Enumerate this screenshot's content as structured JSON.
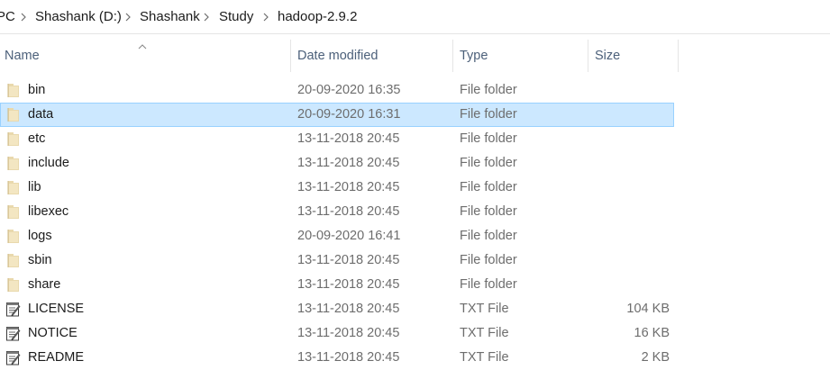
{
  "breadcrumb": {
    "items": [
      {
        "label": "PC"
      },
      {
        "label": "Shashank (D:)"
      },
      {
        "label": "Shashank"
      },
      {
        "label": "Study"
      },
      {
        "label": "hadoop-2.9.2"
      }
    ]
  },
  "columns": {
    "name": "Name",
    "date_modified": "Date modified",
    "type": "Type",
    "size": "Size",
    "sort_indicator_icon": "chevron-up-icon"
  },
  "files": [
    {
      "name": "bin",
      "date": "20-09-2020 16:35",
      "type": "File folder",
      "size": "",
      "icon": "folder-icon",
      "selected": false
    },
    {
      "name": "data",
      "date": "20-09-2020 16:31",
      "type": "File folder",
      "size": "",
      "icon": "folder-icon",
      "selected": true
    },
    {
      "name": "etc",
      "date": "13-11-2018 20:45",
      "type": "File folder",
      "size": "",
      "icon": "folder-icon",
      "selected": false
    },
    {
      "name": "include",
      "date": "13-11-2018 20:45",
      "type": "File folder",
      "size": "",
      "icon": "folder-icon",
      "selected": false
    },
    {
      "name": "lib",
      "date": "13-11-2018 20:45",
      "type": "File folder",
      "size": "",
      "icon": "folder-icon",
      "selected": false
    },
    {
      "name": "libexec",
      "date": "13-11-2018 20:45",
      "type": "File folder",
      "size": "",
      "icon": "folder-icon",
      "selected": false
    },
    {
      "name": "logs",
      "date": "20-09-2020 16:41",
      "type": "File folder",
      "size": "",
      "icon": "folder-icon",
      "selected": false
    },
    {
      "name": "sbin",
      "date": "13-11-2018 20:45",
      "type": "File folder",
      "size": "",
      "icon": "folder-icon",
      "selected": false
    },
    {
      "name": "share",
      "date": "13-11-2018 20:45",
      "type": "File folder",
      "size": "",
      "icon": "folder-icon",
      "selected": false
    },
    {
      "name": "LICENSE",
      "date": "13-11-2018 20:45",
      "type": "TXT File",
      "size": "104 KB",
      "icon": "text-file-icon",
      "selected": false
    },
    {
      "name": "NOTICE",
      "date": "13-11-2018 20:45",
      "type": "TXT File",
      "size": "16 KB",
      "icon": "text-file-icon",
      "selected": false
    },
    {
      "name": "README",
      "date": "13-11-2018 20:45",
      "type": "TXT File",
      "size": "2 KB",
      "icon": "text-file-icon",
      "selected": false
    }
  ],
  "colors": {
    "selection_fill": "#cce8ff",
    "selection_border": "#99d1ff",
    "header_text": "#4c607a",
    "folder": "#e8d6a8"
  }
}
